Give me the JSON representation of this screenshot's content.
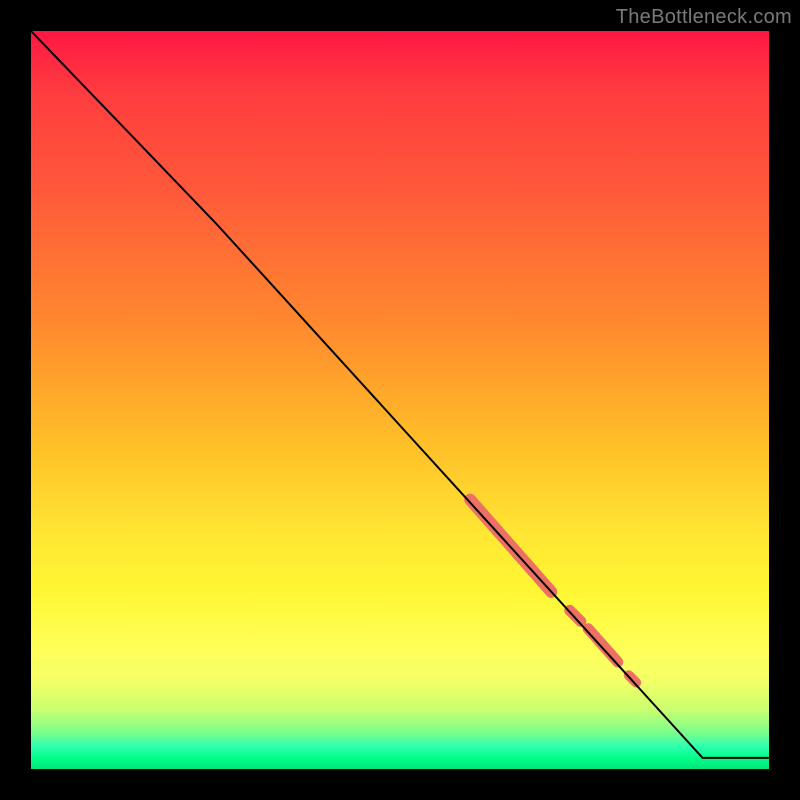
{
  "watermark": "TheBottleneck.com",
  "chart_data": {
    "type": "line",
    "title": "",
    "xlabel": "",
    "ylabel": "",
    "xlim": [
      0,
      100
    ],
    "ylim": [
      0,
      100
    ],
    "grid": false,
    "series": [
      {
        "name": "curve",
        "x": [
          0,
          25,
          91,
          100
        ],
        "y": [
          100,
          74,
          1.5,
          1.5
        ],
        "color": "#000000",
        "stroke_width": 2
      }
    ],
    "highlights": [
      {
        "x0": 59.5,
        "y0": 36.5,
        "x1": 70.5,
        "y1": 24,
        "width": 12,
        "color": "#ec7063"
      },
      {
        "x0": 73.0,
        "y0": 21.5,
        "x1": 74.5,
        "y1": 20,
        "width": 11,
        "color": "#ec7063"
      },
      {
        "x0": 75.5,
        "y0": 19.0,
        "x1": 79.5,
        "y1": 14.5,
        "width": 11,
        "color": "#ec7063"
      },
      {
        "x0": 81.0,
        "y0": 12.7,
        "x1": 82.0,
        "y1": 11.7,
        "width": 10,
        "color": "#ec7063"
      }
    ],
    "background_gradient": {
      "direction": "vertical",
      "stops": [
        {
          "pos": 0.0,
          "color": "#ff1744"
        },
        {
          "pos": 0.08,
          "color": "#ff3b3f"
        },
        {
          "pos": 0.22,
          "color": "#ff5a3a"
        },
        {
          "pos": 0.4,
          "color": "#ff8a2e"
        },
        {
          "pos": 0.56,
          "color": "#ffbf28"
        },
        {
          "pos": 0.68,
          "color": "#ffe633"
        },
        {
          "pos": 0.76,
          "color": "#fff733"
        },
        {
          "pos": 0.84,
          "color": "#ffff5a"
        },
        {
          "pos": 0.88,
          "color": "#f4ff66"
        },
        {
          "pos": 0.92,
          "color": "#c8ff70"
        },
        {
          "pos": 0.95,
          "color": "#7dff8a"
        },
        {
          "pos": 0.97,
          "color": "#2cffb0"
        },
        {
          "pos": 0.985,
          "color": "#00ff88"
        },
        {
          "pos": 1.0,
          "color": "#00e67a"
        }
      ]
    }
  }
}
